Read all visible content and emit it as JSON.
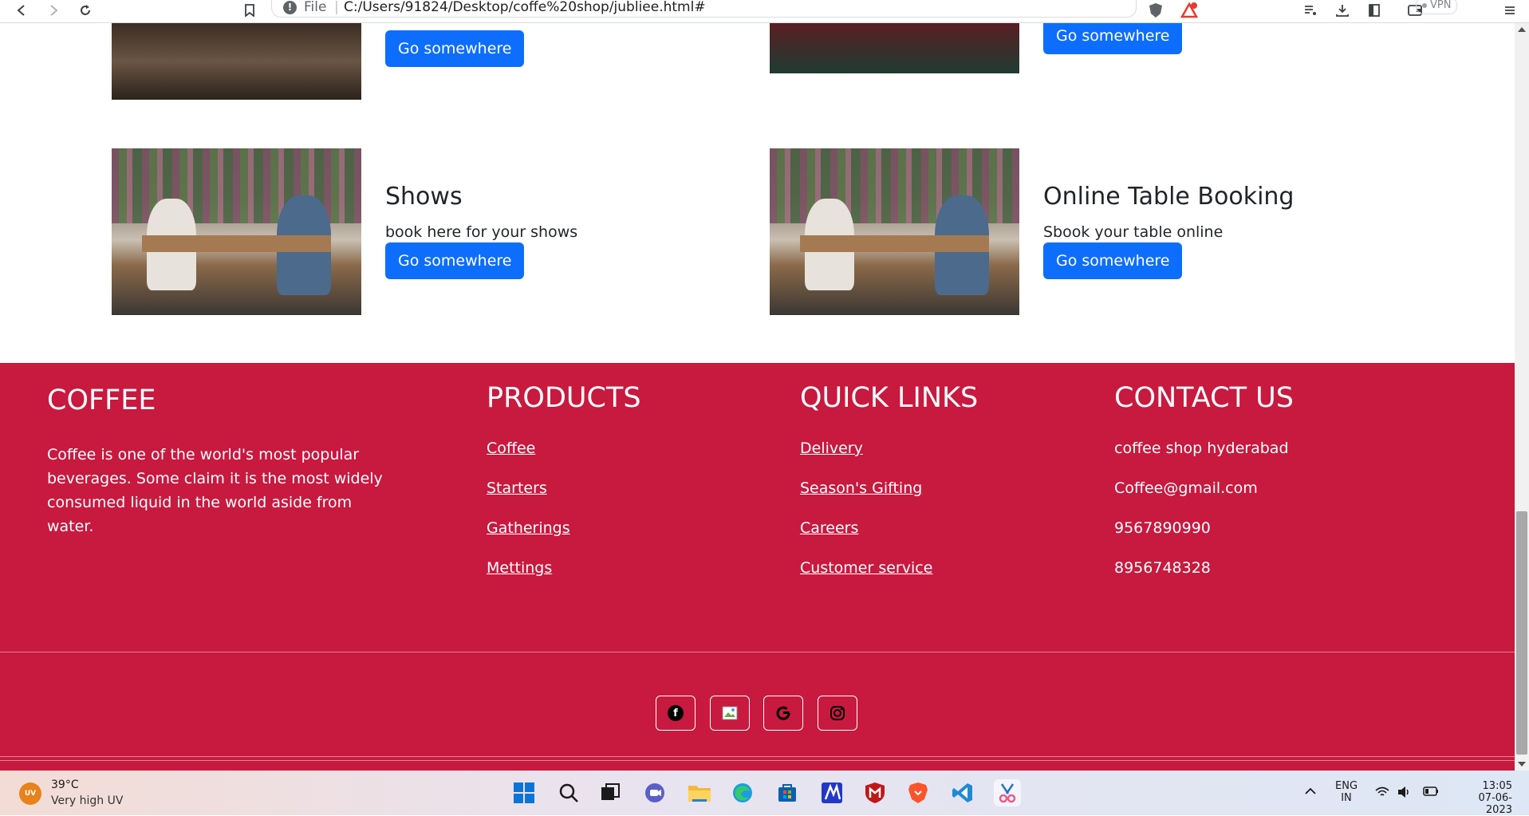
{
  "browser": {
    "file_label": "File",
    "url": "C:/Users/91824/Desktop/coffe%20shop/jubliee.html#",
    "vpn_label": "VPN"
  },
  "cards": [
    {
      "title": "Shows",
      "text": "book here for your shows",
      "button": "Go somewhere"
    },
    {
      "title": "Online Table Booking",
      "text": "Sbook your table online",
      "button": "Go somewhere"
    }
  ],
  "top_cards": [
    {
      "button": "Go somewhere"
    },
    {
      "button": "Go somewhere"
    }
  ],
  "footer": {
    "brand": "COFFEE",
    "description": "Coffee is one of the world's most popular beverages. Some claim it is the most widely consumed liquid in the world aside from water.",
    "products_title": "PRODUCTS",
    "products": [
      "Coffee",
      "Starters",
      "Gatherings",
      "Mettings"
    ],
    "quick_links_title": "QUICK LINKS",
    "quick_links": [
      "Delivery",
      "Season's Gifting",
      "Careers",
      "Customer service"
    ],
    "contact_title": "CONTACT US",
    "contact": [
      "coffee shop hyderabad",
      "Coffee@gmail.com",
      "9567890990",
      "8956748328"
    ],
    "social": [
      "facebook-icon",
      "broken-image-icon",
      "google-icon",
      "instagram-icon"
    ],
    "background_color": "#c8193f"
  },
  "taskbar": {
    "weather_badge": "UV",
    "temperature": "39°C",
    "weather_text": "Very high UV",
    "lang_top": "ENG",
    "lang_bottom": "IN",
    "time": "13:05",
    "date": "07-06-2023"
  }
}
